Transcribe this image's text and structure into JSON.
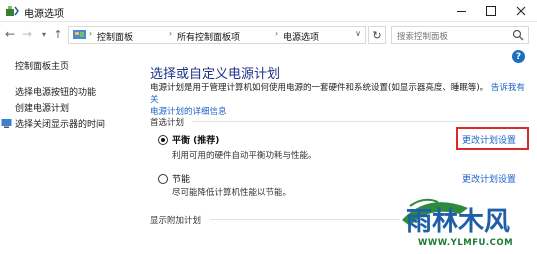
{
  "window": {
    "title": "电源选项"
  },
  "address_bar": {
    "crumbs": [
      "控制面板",
      "所有控制面板项",
      "电源选项"
    ],
    "search_placeholder": "搜索控制面板"
  },
  "help": {
    "label": "?"
  },
  "sidebar": {
    "items": [
      {
        "label": "控制面板主页"
      },
      {
        "label": "选择电源按钮的功能"
      },
      {
        "label": "创建电源计划"
      },
      {
        "label": "选择关闭显示器的时间"
      }
    ]
  },
  "main": {
    "title": "选择或自定义电源计划",
    "desc_text": "电源计划是用于管理计算机如何使用电源的一套硬件和系统设置(如显示器亮度、睡眠等)。",
    "desc_link_1": "告诉我有关",
    "desc_link_2": "电源计划的详细信息",
    "preferred_label": "首选计划",
    "plans": [
      {
        "name": "平衡 (推荐)",
        "desc": "利用可用的硬件自动平衡功耗与性能。",
        "link": "更改计划设置",
        "selected": true
      },
      {
        "name": "节能",
        "desc": "尽可能降低计算机性能以节能。",
        "link": "更改计划设置",
        "selected": false
      }
    ],
    "additional_label": "显示附加计划"
  },
  "watermark": {
    "logo_text": "雨林木风",
    "url_text": "WWW.YLMFU.COM"
  },
  "colors": {
    "accent_title": "#1e3287",
    "link": "#1e63c9",
    "highlight": "#d92b2b"
  }
}
